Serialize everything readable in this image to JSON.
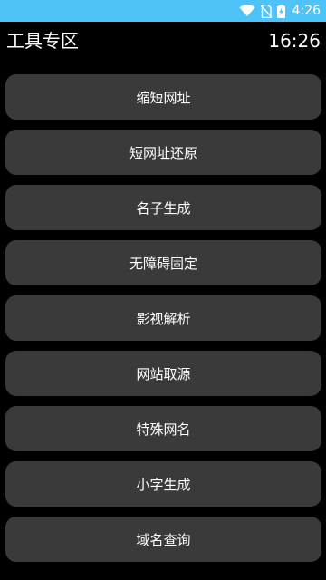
{
  "status_bar": {
    "time": "4:26",
    "background": "#4fc3f7",
    "icons": [
      "wifi-icon",
      "no-sim-icon",
      "battery-charging-icon"
    ]
  },
  "app_bar": {
    "title": "工具专区",
    "clock": "16:26"
  },
  "tools": [
    {
      "label": "缩短网址"
    },
    {
      "label": "短网址还原"
    },
    {
      "label": "名子生成"
    },
    {
      "label": "无障碍固定"
    },
    {
      "label": "影视解析"
    },
    {
      "label": "网站取源"
    },
    {
      "label": "特殊网名"
    },
    {
      "label": "小字生成"
    },
    {
      "label": "域名查询"
    }
  ],
  "colors": {
    "background": "#000000",
    "button": "#3a3a3a",
    "text": "#ffffff"
  }
}
